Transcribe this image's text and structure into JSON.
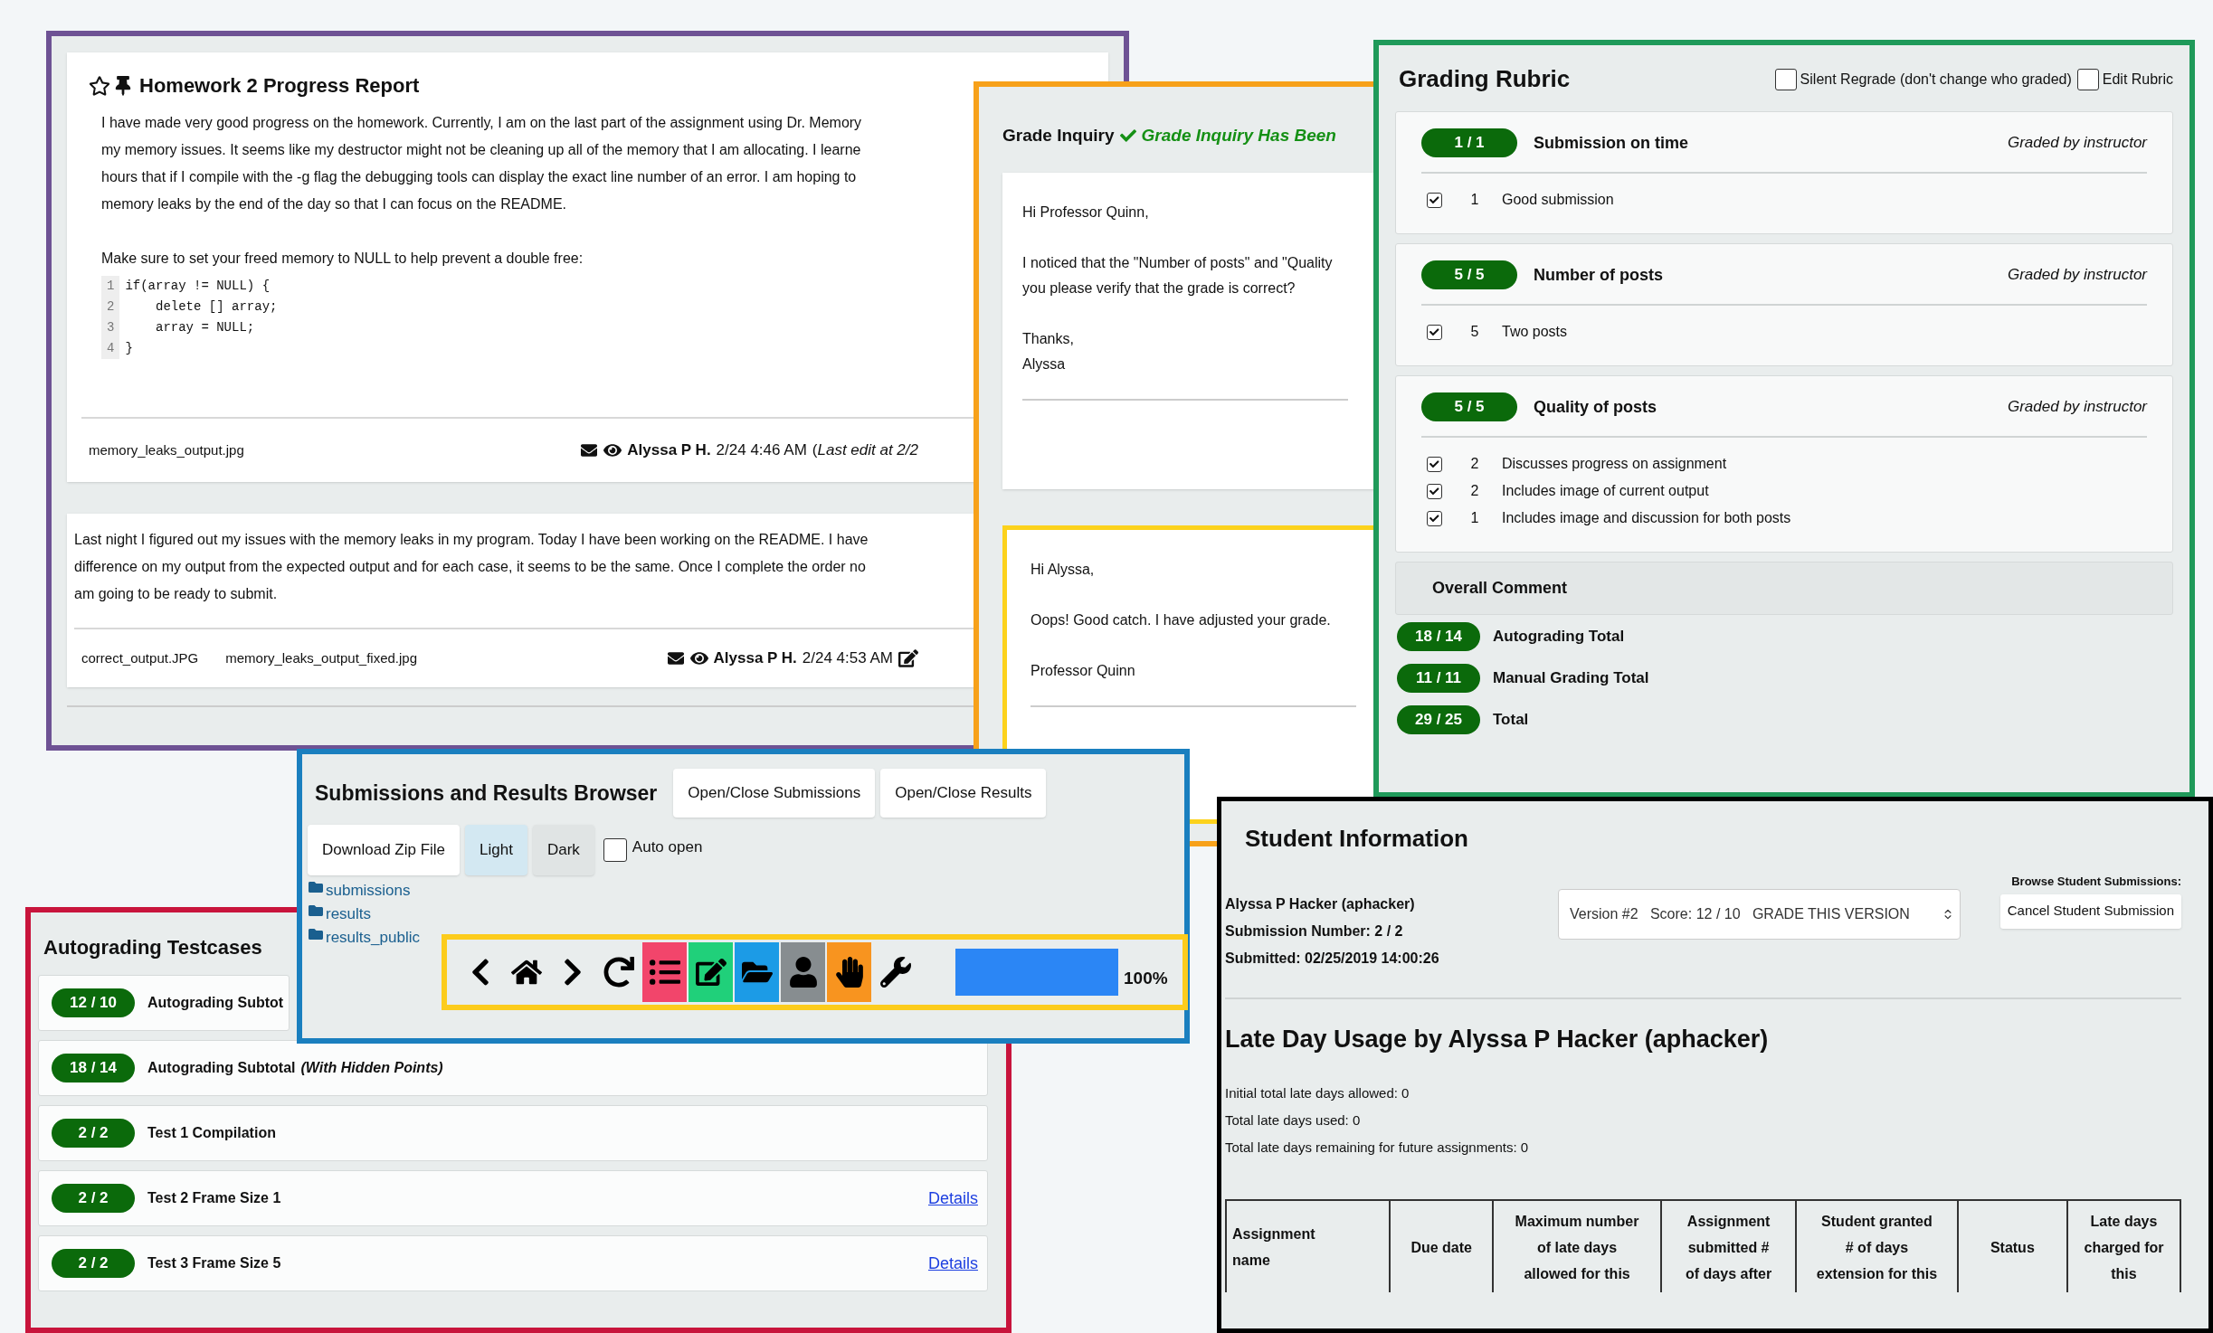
{
  "discussion": {
    "title": "Homework 2 Progress Report",
    "posts": [
      {
        "lines": [
          "I have made very good progress on the homework. Currently, I am on the last part of the assignment using Dr. Memory",
          "my memory issues. It seems like my destructor might not be cleaning up all of the memory that I am allocating. I learne",
          "hours that if I compile with the -g flag the debugging tools can display the exact line number of an error. I am hoping to",
          "memory leaks by the end of the day so that I can focus on the README."
        ],
        "note": "Make sure to set your freed memory to NULL to help prevent a double free:",
        "code": [
          {
            "number": "1",
            "text": "if(array != NULL) {"
          },
          {
            "number": "2",
            "text": "    delete [] array;"
          },
          {
            "number": "3",
            "text": "    array = NULL;"
          },
          {
            "number": "4",
            "text": "}"
          }
        ],
        "attachments": [
          "memory_leaks_output.jpg"
        ],
        "author": "Alyssa P H.",
        "time": "2/24 4:46 AM",
        "edit_note": "(*Last edit at 2/2*",
        "editable": false
      },
      {
        "lines": [
          "Last night I figured out my issues with the memory leaks in my program. Today I have been working on the README. I have",
          "difference on my output from the expected output and for each case, it seems to be the same. Once I complete the order no",
          "am going to be ready to submit."
        ],
        "attachments": [
          "correct_output.JPG",
          "memory_leaks_output_fixed.jpg"
        ],
        "author": "Alyssa P H.",
        "time": "2/24 4:53 AM",
        "editable": true
      }
    ]
  },
  "grade_inquiry": {
    "title": "Grade Inquiry",
    "status": "Grade Inquiry Has Been",
    "messages": [
      {
        "paragraphs": [
          [
            "Hi Professor Quinn,"
          ],
          [
            "I noticed that the \"Number of posts\" and \"Quality",
            "you please verify that the grade is correct?"
          ],
          [
            "Thanks,",
            "Alyssa"
          ]
        ]
      },
      {
        "paragraphs": [
          [
            "Hi Alyssa,"
          ],
          [
            "Oops! Good catch. I have adjusted your grade."
          ],
          [
            "Professor Quinn"
          ]
        ]
      }
    ]
  },
  "rubric": {
    "title": "Grading Rubric",
    "options": [
      {
        "label": "Silent Regrade (don't change who graded)",
        "checked": false
      },
      {
        "label": "Edit Rubric",
        "checked": false
      }
    ],
    "components": [
      {
        "score": "1 / 1",
        "title": "Submission on time",
        "graded_by": "Graded by instructor",
        "marks": [
          {
            "checked": true,
            "points": "1",
            "text": "Good submission"
          }
        ]
      },
      {
        "score": "5 / 5",
        "title": "Number of posts",
        "graded_by": "Graded by instructor",
        "marks": [
          {
            "checked": true,
            "points": "5",
            "text": "Two posts"
          }
        ]
      },
      {
        "score": "5 / 5",
        "title": "Quality of posts",
        "graded_by": "Graded by instructor",
        "marks": [
          {
            "checked": true,
            "points": "2",
            "text": "Discusses progress on assignment"
          },
          {
            "checked": true,
            "points": "2",
            "text": "Includes image of current output"
          },
          {
            "checked": true,
            "points": "1",
            "text": "Includes image and discussion for both posts"
          }
        ]
      }
    ],
    "overall_comment": "Overall Comment",
    "totals": [
      {
        "score": "18 / 14",
        "label": "Autograding Total"
      },
      {
        "score": "11 / 11",
        "label": "Manual Grading Total"
      },
      {
        "score": "29 / 25",
        "label": "Total"
      }
    ]
  },
  "browser": {
    "title": "Submissions and Results Browser",
    "buttons": [
      "Open/Close Submissions",
      "Open/Close Results"
    ],
    "download": "Download Zip File",
    "modes": [
      {
        "label": "Light",
        "selected": true
      },
      {
        "label": "Dark",
        "selected": false
      }
    ],
    "auto_open": {
      "label": "Auto open",
      "checked": false
    },
    "folders": [
      "submissions",
      "results",
      "results_public"
    ],
    "toolbar": {
      "tools": [
        {
          "kind": "back"
        },
        {
          "kind": "home"
        },
        {
          "kind": "forward"
        },
        {
          "kind": "refresh"
        },
        {
          "kind": "list",
          "color": "#f2456b"
        },
        {
          "kind": "edit",
          "color": "#20d07a"
        },
        {
          "kind": "folder",
          "color": "#1c9be6"
        },
        {
          "kind": "user",
          "color": "#878d90"
        },
        {
          "kind": "hand",
          "color": "#f8941f"
        },
        {
          "kind": "wrench"
        }
      ],
      "progress": {
        "level": 1,
        "reading": "100%"
      }
    }
  },
  "autograding": {
    "title": "Autograding Testcases",
    "rows": [
      {
        "score": "12 / 10",
        "label": "Autograding Subtot"
      },
      {
        "score": "18 / 14",
        "label": "Autograding Subtotal",
        "note": "(With Hidden Points)"
      },
      {
        "score": "2 / 2",
        "label": "Test 1 Compilation"
      },
      {
        "score": "2 / 2",
        "label": "Test 2 Frame Size 1",
        "link": "Details"
      },
      {
        "score": "2 / 2",
        "label": "Test 3 Frame Size 5",
        "link": "Details"
      }
    ]
  },
  "student": {
    "title": "Student Information",
    "details": [
      "Alyssa P Hacker (aphacker)",
      "Submission Number: 2 / 2",
      "Submitted: 02/25/2019 14:00:26"
    ],
    "version_select": "Version #2   Score: 12 / 10   GRADE THIS VERSION",
    "browse_label": "Browse Student Submissions:",
    "cancel_button": "Cancel Student Submission",
    "late_heading": "Late Day Usage by Alyssa P Hacker (aphacker)",
    "late_lines": [
      "Initial total late days allowed: 0",
      "Total late days used: 0",
      "Total late days remaining for future assignments: 0"
    ],
    "table": {
      "columns": [
        [
          "Assignment",
          "name"
        ],
        [
          "Due date"
        ],
        [
          "Maximum number",
          "of late days",
          "allowed for this"
        ],
        [
          "Assignment",
          "submitted #",
          "of days after"
        ],
        [
          "Student granted",
          "# of days",
          "extension for this"
        ],
        [
          "Status"
        ],
        [
          "Late days",
          "charged for",
          "this"
        ]
      ]
    }
  }
}
